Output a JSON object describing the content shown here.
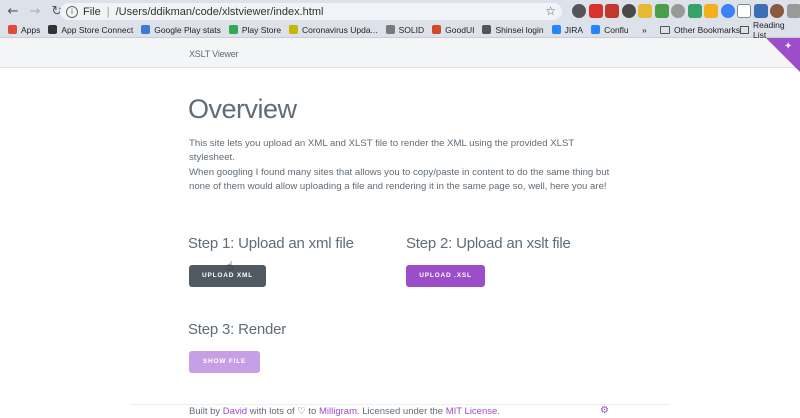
{
  "browser": {
    "address_scheme": "File",
    "address_path": "/Users/ddikman/code/xlstviewer/index.html",
    "back_icon": "arrow-left-icon",
    "forward_icon": "arrow-right-icon",
    "reload_icon": "reload-icon",
    "info_icon": "info-icon",
    "star_icon": "star-icon",
    "glyph_back": "←",
    "glyph_forward": "→",
    "glyph_reload": "↻",
    "glyph_info": "i",
    "glyph_star": "☆",
    "extension_colors": [
      "#555555",
      "#d9322b",
      "#c0392b",
      "#4a4a4a",
      "#e8b931",
      "#4a9e4a",
      "#999999",
      "#38a169",
      "#f2b01e",
      "#3b82f6",
      "#ffffff",
      "#3b6fb6",
      "#8b5a3c",
      "#999999"
    ]
  },
  "bookmarks": {
    "items": [
      {
        "label": "Apps",
        "color": "#e04a3a"
      },
      {
        "label": "App Store Connect",
        "color": "#333333"
      },
      {
        "label": "Google Play stats",
        "color": "#3a7bd5"
      },
      {
        "label": "Play Store",
        "color": "#34a853"
      },
      {
        "label": "Coronavirus Upda...",
        "color": "#c8b600"
      },
      {
        "label": "SOLID",
        "color": "#7a7a7a"
      },
      {
        "label": "GoodUI",
        "color": "#d04a2a"
      },
      {
        "label": "Shinsei login",
        "color": "#555555"
      },
      {
        "label": "JIRA",
        "color": "#2684ff"
      },
      {
        "label": "Conflu",
        "color": "#2684ff"
      }
    ],
    "more_label": "»",
    "other": "Other Bookmarks",
    "reading_list": "Reading List"
  },
  "site": {
    "title": "XSLT Viewer",
    "corner_glyph": "✦"
  },
  "main": {
    "heading": "Overview",
    "para1": "This site lets you upload an XML and XLST file to render the XML using the provided XLST stylesheet.",
    "para2": "When googling I found many sites that allows you to copy/paste in content to do the same thing but none of them would allow uploading a file and rendering it in the same page so, well, here you are!",
    "step1": "Step 1: Upload an xml file",
    "step2": "Step 2: Upload an xslt file",
    "step3": "Step 3: Render",
    "btn_xml": "Upload XML",
    "btn_xsl": "Upload .XSL",
    "btn_show": "Show File",
    "cursor_glyph": "☝"
  },
  "footer": {
    "t1": "Built by ",
    "author": "David",
    "t2": " with lots of ♡ to ",
    "milligram": "Milligram",
    "t3": ". Licensed under the ",
    "license": "MIT License",
    "t4": ".",
    "github_glyph": "⚙"
  },
  "colors": {
    "accent": "#9b4dca",
    "text": "#606c76",
    "dark_button": "#505862",
    "disabled_button": "#c79fe4"
  }
}
